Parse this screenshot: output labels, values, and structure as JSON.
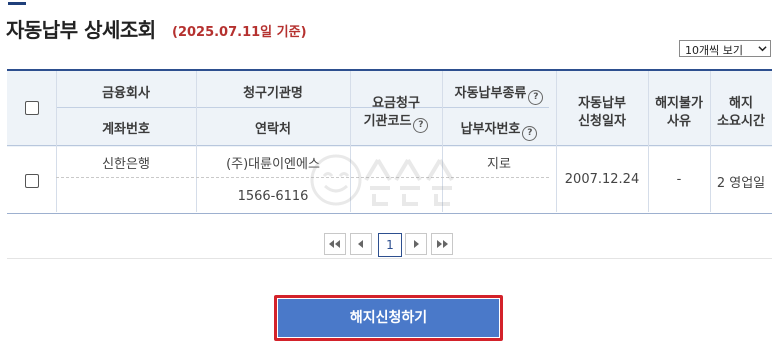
{
  "page": {
    "title": "자동납부 상세조회",
    "subtitle": "(2025.07.11일 기준)",
    "per_page": "10개씩 보기"
  },
  "table": {
    "headers": {
      "col1_top": "금융회사",
      "col1_bottom": "계좌번호",
      "col2_top": "청구기관명",
      "col2_bottom": "연락처",
      "col3_line1": "요금청구",
      "col3_line2": "기관코드",
      "col4_top": "자동납부종류",
      "col4_bottom": "납부자번호",
      "col5_line1": "자동납부",
      "col5_line2": "신청일자",
      "col6_line1": "해지불가",
      "col6_line2": "사유",
      "col7_line1": "해지",
      "col7_line2": "소요시간",
      "help_glyph": "?"
    },
    "rows": [
      {
        "bank": "신한은행",
        "account": "",
        "billing_org": "(주)대륜이엔에스",
        "contact": "1566-6116",
        "org_code": "",
        "payment_type": "지로",
        "payer_no": "",
        "applied_date": "2007.12.24",
        "reason": "-",
        "duration": "2 영업일"
      }
    ]
  },
  "pagination": {
    "current": "1",
    "first_icon": "double-chevron-left-icon",
    "prev_icon": "chevron-left-icon",
    "next_icon": "chevron-right-icon",
    "last_icon": "double-chevron-right-icon"
  },
  "actions": {
    "cancel_label": "해지신청하기"
  },
  "colors": {
    "accent": "#2d4f8f",
    "subtitle": "#b5312f",
    "button": "#4a79c9",
    "button_border": "#d3222a"
  }
}
